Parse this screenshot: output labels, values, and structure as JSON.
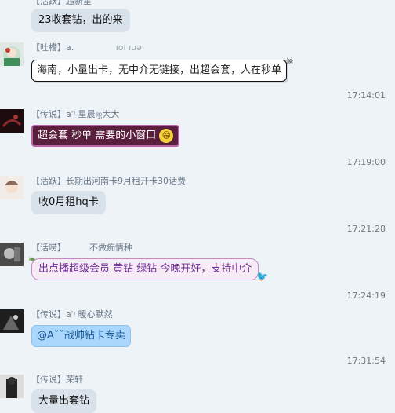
{
  "messages": [
    {
      "tag": "【活跃】",
      "name": "超新星",
      "text": "23收套钻，出的来"
    },
    {
      "tag": "【吐槽】",
      "name": "a.",
      "name_extra": "ıoı ıuǝ",
      "text": "海南，小量出卡，无中介无链接，出超会套，人在秒单"
    },
    {
      "time": "17:14:01"
    },
    {
      "tag": "【传说】",
      "name": "aʾᵎ 星晨ஐ大大",
      "text": "超会套 秒单 需要的小窗口"
    },
    {
      "time": "17:19:00"
    },
    {
      "tag": "【活跃】",
      "name": "长期出河南卡9月租开卡30话费",
      "text": "收0月租hq卡"
    },
    {
      "time": "17:21:28"
    },
    {
      "tag": "【话唠】",
      "name": "不做痴情种",
      "text": "出点播超级会员  黄钻 绿钻 今晚开好，支持中介"
    },
    {
      "time": "17:24:19"
    },
    {
      "tag": "【传说】",
      "name": "aʾᵎ 暖心默然",
      "text": "@A˘ˇ战帅钻卡专卖"
    },
    {
      "time": "17:31:54"
    },
    {
      "tag": "【传说】",
      "name": "荣轩",
      "text": "大量出套钻"
    }
  ],
  "icons": {
    "grin": "grin-emoji",
    "skull": "skull-deco",
    "leaf": "leaf-deco",
    "bird": "bird-deco"
  }
}
